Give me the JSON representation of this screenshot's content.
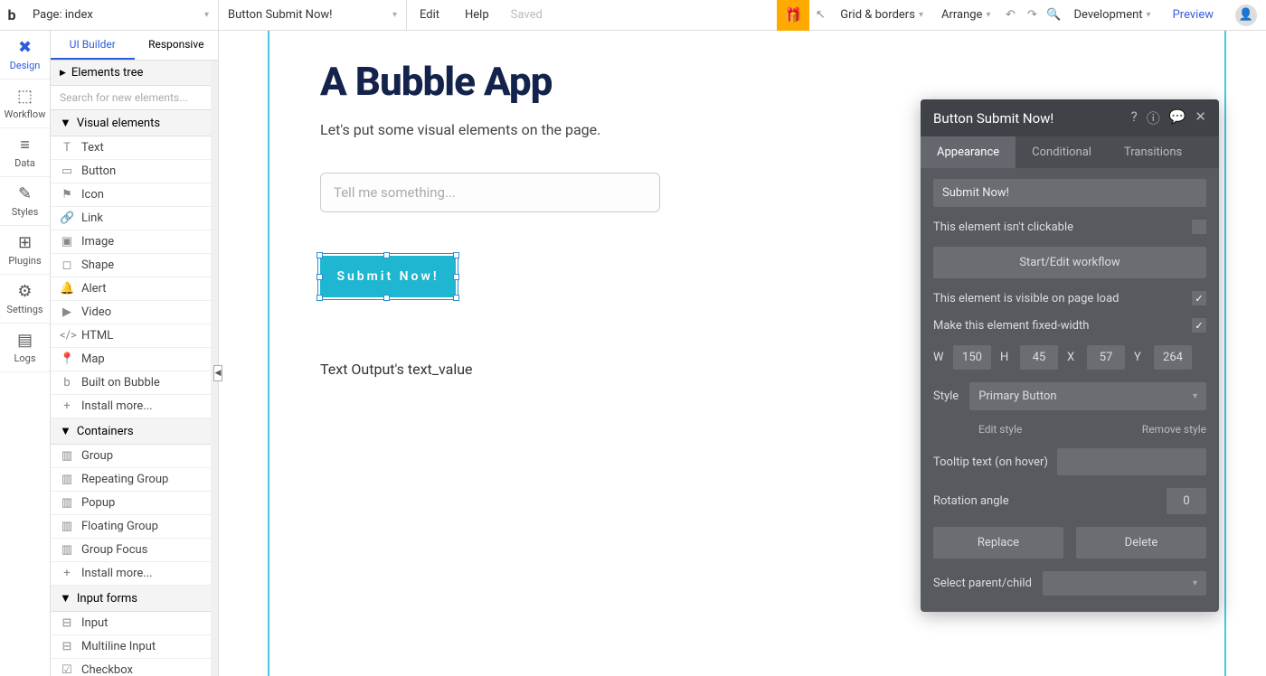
{
  "topbar": {
    "page_label": "Page: index",
    "element_label": "Button Submit Now!",
    "edit": "Edit",
    "help": "Help",
    "saved": "Saved",
    "grid": "Grid & borders",
    "arrange": "Arrange",
    "env": "Development",
    "preview": "Preview"
  },
  "rail": [
    {
      "label": "Design",
      "icon": "✖"
    },
    {
      "label": "Workflow",
      "icon": "⇄"
    },
    {
      "label": "Data",
      "icon": "≡"
    },
    {
      "label": "Styles",
      "icon": "✎"
    },
    {
      "label": "Plugins",
      "icon": "⊞"
    },
    {
      "label": "Settings",
      "icon": "⚙"
    },
    {
      "label": "Logs",
      "icon": "▤"
    }
  ],
  "panel": {
    "tab_ui": "UI Builder",
    "tab_resp": "Responsive",
    "elements_tree": "Elements tree",
    "search_ph": "Search for new elements...",
    "sec_visual": "Visual elements",
    "visual_items": [
      {
        "icon": "T",
        "label": "Text"
      },
      {
        "icon": "▭",
        "label": "Button"
      },
      {
        "icon": "⚑",
        "label": "Icon"
      },
      {
        "icon": "🔗",
        "label": "Link"
      },
      {
        "icon": "▣",
        "label": "Image"
      },
      {
        "icon": "◻",
        "label": "Shape"
      },
      {
        "icon": "🔔",
        "label": "Alert"
      },
      {
        "icon": "▶",
        "label": "Video"
      },
      {
        "icon": "</>",
        "label": "HTML"
      },
      {
        "icon": "📍",
        "label": "Map"
      },
      {
        "icon": "b",
        "label": "Built on Bubble"
      },
      {
        "icon": "+",
        "label": "Install more..."
      }
    ],
    "sec_containers": "Containers",
    "container_items": [
      {
        "icon": "▥",
        "label": "Group"
      },
      {
        "icon": "▥",
        "label": "Repeating Group"
      },
      {
        "icon": "▥",
        "label": "Popup"
      },
      {
        "icon": "▥",
        "label": "Floating Group"
      },
      {
        "icon": "▥",
        "label": "Group Focus"
      },
      {
        "icon": "+",
        "label": "Install more..."
      }
    ],
    "sec_input": "Input forms",
    "input_items": [
      {
        "icon": "⊟",
        "label": "Input"
      },
      {
        "icon": "⊟",
        "label": "Multiline Input"
      },
      {
        "icon": "☑",
        "label": "Checkbox"
      }
    ]
  },
  "canvas": {
    "title": "A Bubble App",
    "subtitle": "Let's put some visual elements on the page.",
    "input_ph": "Tell me something...",
    "button_label": "Submit Now!",
    "output_text": "Text Output's text_value"
  },
  "prop": {
    "title": "Button Submit Now!",
    "tab_appearance": "Appearance",
    "tab_conditional": "Conditional",
    "tab_transitions": "Transitions",
    "value": "Submit Now!",
    "not_clickable": "This element isn't clickable",
    "start_workflow": "Start/Edit workflow",
    "visible_load": "This element is visible on page load",
    "fixed_width": "Make this element fixed-width",
    "W": "W",
    "w_val": "150",
    "H": "H",
    "h_val": "45",
    "X": "X",
    "x_val": "57",
    "Y": "Y",
    "y_val": "264",
    "style_label": "Style",
    "style_value": "Primary Button",
    "edit_style": "Edit style",
    "remove_style": "Remove style",
    "tooltip_label": "Tooltip text (on hover)",
    "rotation_label": "Rotation angle",
    "rotation_val": "0",
    "replace": "Replace",
    "delete": "Delete",
    "select_parent": "Select parent/child"
  }
}
